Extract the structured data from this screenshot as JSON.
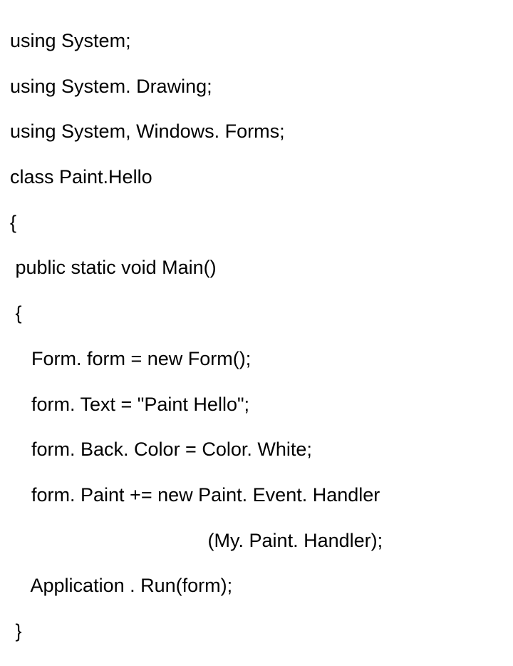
{
  "code": {
    "l1": "using System;",
    "l2": "using System. Drawing;",
    "l3": "using System, Windows. Forms;",
    "l4": "class Paint.Hello",
    "l5": "{",
    "l6": " public static void Main()",
    "l7": " {",
    "l8": "    Form. form = new Form();",
    "l9": "    form. Text = \"Paint Hello\";",
    "l10": "    form. Back. Color = Color. White;",
    "l11": "    form. Paint += new Paint. Event. Handler",
    "l12": "                                     (My. Paint. Handler);",
    "l13": "    Application . Run(form);",
    "l14": " }"
  }
}
